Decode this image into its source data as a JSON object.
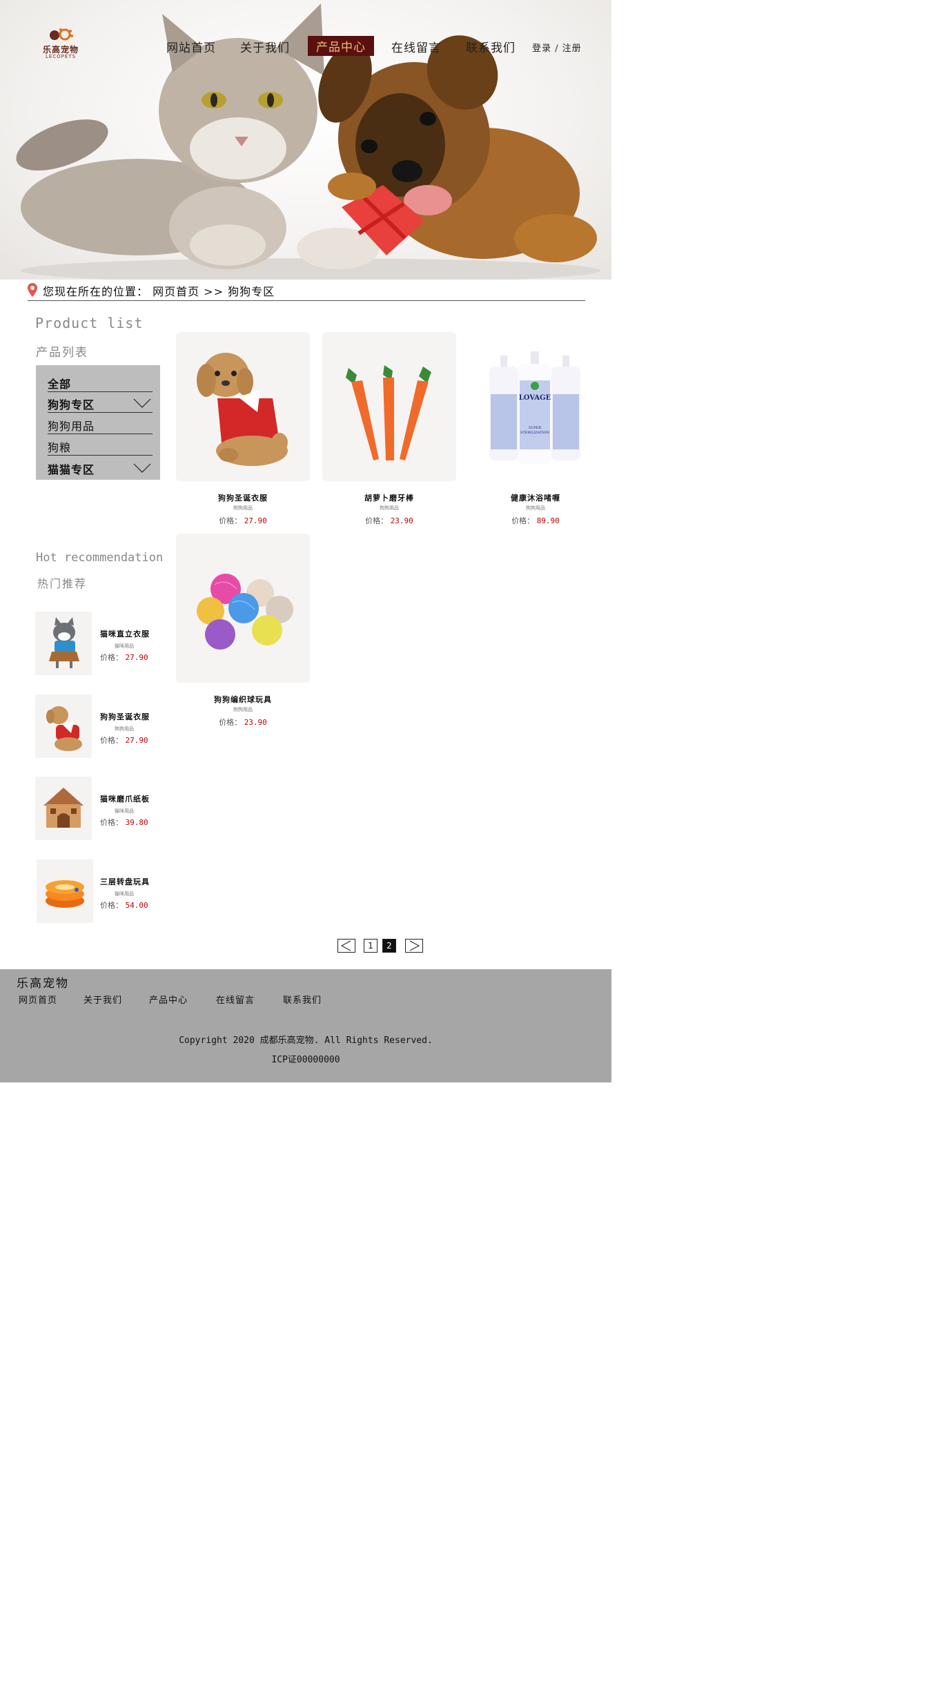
{
  "brand": {
    "name_cn": "乐高宠物",
    "name_en": "LECOPETS"
  },
  "nav": {
    "items": [
      "网站首页",
      "关于我们",
      "产品中心",
      "在线留言",
      "联系我们"
    ],
    "active": "产品中心",
    "login": "登录 / 注册"
  },
  "breadcrumb": {
    "text": "您现在所在的位置： 网页首页 >> 狗狗专区"
  },
  "sidebar": {
    "title_en": "Product list",
    "title_cn": "产品列表",
    "categories": [
      {
        "label": "全部"
      },
      {
        "label": "狗狗专区"
      },
      {
        "label": "狗狗用品"
      },
      {
        "label": "狗粮"
      },
      {
        "label": "猫猫专区"
      }
    ],
    "hot_en": "Hot recommendation",
    "hot_cn": "热门推荐"
  },
  "price_label": "价格：",
  "hot_items": [
    {
      "name": "猫咪直立衣服",
      "category": "猫咪用品",
      "price": "27.90",
      "icon": "cat-clothes-icon"
    },
    {
      "name": "狗狗圣诞衣服",
      "category": "狗狗用品",
      "price": "27.90",
      "icon": "dog-clothes-icon"
    },
    {
      "name": "猫咪磨爪纸板",
      "category": "猫咪用品",
      "price": "39.80",
      "icon": "cat-house-icon"
    },
    {
      "name": "三层转盘玩具",
      "category": "猫咪用品",
      "price": "54.00",
      "icon": "turntable-toy-icon"
    }
  ],
  "products": [
    {
      "name": "狗狗圣诞衣服",
      "category": "狗狗用品",
      "price": "27.90",
      "icon": "dog-clothes-icon"
    },
    {
      "name": "胡萝卜磨牙棒",
      "category": "狗狗用品",
      "price": "23.90",
      "icon": "carrot-chew-icon"
    },
    {
      "name": "健康沐浴啫喱",
      "category": "狗狗用品",
      "price": "89.90",
      "icon": "shampoo-bottle-icon"
    },
    {
      "name": "狗狗编织球玩具",
      "category": "狗狗用品",
      "price": "23.90",
      "icon": "yarn-ball-icon"
    }
  ],
  "product_image_text": {
    "brand": "LOVAGE",
    "line1": "SUPER",
    "line2": "STERILIZATION"
  },
  "pagination": {
    "prev": "<",
    "pages": [
      "1",
      "2"
    ],
    "current": "2",
    "next": ">"
  },
  "footer": {
    "title": "乐高宠物",
    "links": [
      "网页首页",
      "关于我们",
      "产品中心",
      "在线留言",
      "联系我们"
    ],
    "copyright": "Copyright 2020 成都乐高宠物. All Rights Reserved.",
    "icp": "ICP证00000000"
  },
  "colors": {
    "active_nav_bg": "#5a1010",
    "active_nav_text": "#f0c070",
    "price": "#c00000",
    "category_bg": "#bdbdbd",
    "footer_bg": "#a6a6a6"
  }
}
